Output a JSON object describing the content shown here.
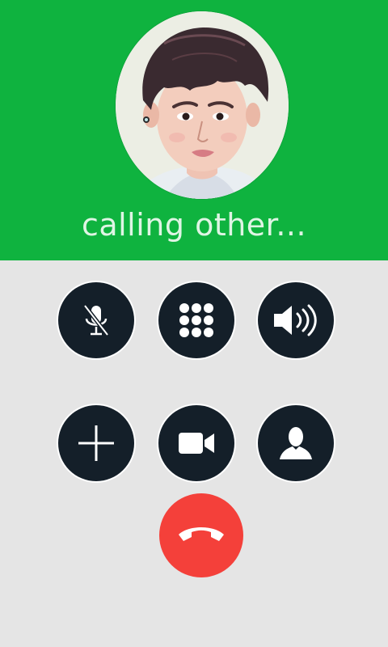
{
  "call": {
    "status_text": "calling other..."
  },
  "colors": {
    "header_bg": "#0fb33f",
    "body_bg": "#e5e5e5",
    "button_bg": "#141f29",
    "end_call_bg": "#f4403a"
  },
  "controls": [
    {
      "name": "mute-button",
      "icon": "microphone-muted-icon"
    },
    {
      "name": "keypad-button",
      "icon": "dialpad-icon"
    },
    {
      "name": "speaker-button",
      "icon": "speaker-icon"
    },
    {
      "name": "add-call-button",
      "icon": "plus-icon"
    },
    {
      "name": "video-button",
      "icon": "video-camera-icon"
    },
    {
      "name": "contacts-button",
      "icon": "person-icon"
    }
  ],
  "end_call": {
    "icon": "phone-hangup-icon"
  }
}
